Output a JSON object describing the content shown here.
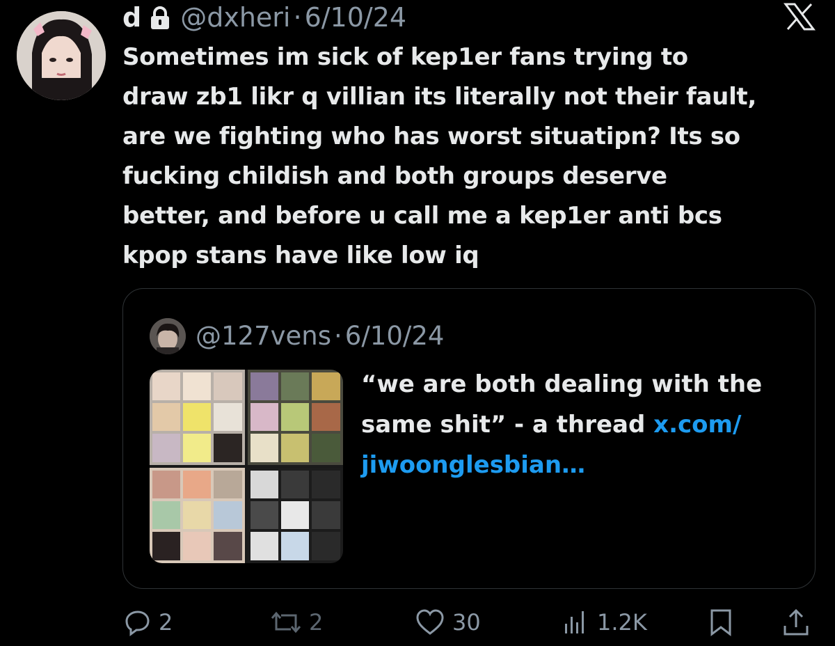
{
  "author": {
    "name": "d",
    "handle": "@dxheri",
    "separator": "·",
    "date": "6/10/24",
    "locked": true
  },
  "tweet": {
    "lines": [
      "Sometimes im sick of kep1er fans trying to",
      "draw zb1 likr q villian its literally not their fault,",
      "are we fighting who has worst situatipn? Its so",
      "fucking childish and both groups deserve",
      "better, and before u call me a kep1er anti bcs",
      "kpop stans have like low iq"
    ]
  },
  "quote": {
    "handle": "@127vens",
    "separator": "·",
    "date": "6/10/24",
    "text_line1": "“we are both dealing with the",
    "text_line2_plain": "same shit” - a thread ",
    "text_line2_link": "x.com/",
    "text_line3_link": "jiwoonglesbian…"
  },
  "actions": {
    "replies": "2",
    "reposts": "2",
    "likes": "30",
    "views": "1.2K"
  },
  "icons": {
    "close": "x-logo-icon",
    "lock": "lock-icon",
    "reply": "reply-icon",
    "repost": "repost-icon",
    "like": "heart-icon",
    "views": "views-icon",
    "bookmark": "bookmark-icon",
    "share": "share-icon"
  },
  "colors": {
    "background": "#000000",
    "text": "#e7e9ea",
    "muted": "#8b98a5",
    "link": "#1d9bf0",
    "border": "#2f3336"
  }
}
